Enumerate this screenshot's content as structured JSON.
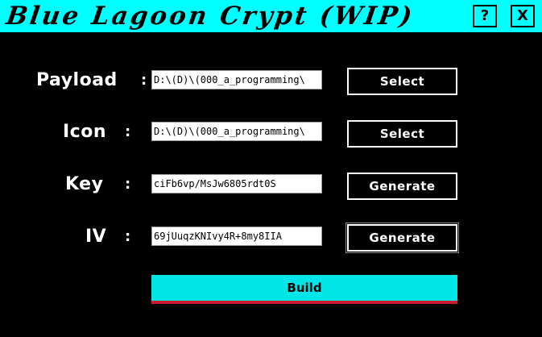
{
  "window": {
    "title": "Blue Lagoon Crypt (WIP)",
    "help_label": "?",
    "close_label": "X"
  },
  "colors": {
    "titlebar_bg": "#00ffff",
    "body_bg": "#000000",
    "build_bg": "#00e5e5",
    "build_underline": "#cc1a33"
  },
  "rows": [
    {
      "label": "Payload",
      "colon": ":",
      "value": "D:\\(D)\\(000_a_programming\\",
      "button": "Select"
    },
    {
      "label": "Icon",
      "colon": ":",
      "value": "D:\\(D)\\(000_a_programming\\",
      "button": "Select"
    },
    {
      "label": "Key",
      "colon": ":",
      "value": "ciFb6vp/MsJw6805rdt0S",
      "button": "Generate"
    },
    {
      "label": "IV",
      "colon": ":",
      "value": "69jUuqzKNIvy4R+8my8IIA",
      "button": "Generate"
    }
  ],
  "build_label": "Build"
}
